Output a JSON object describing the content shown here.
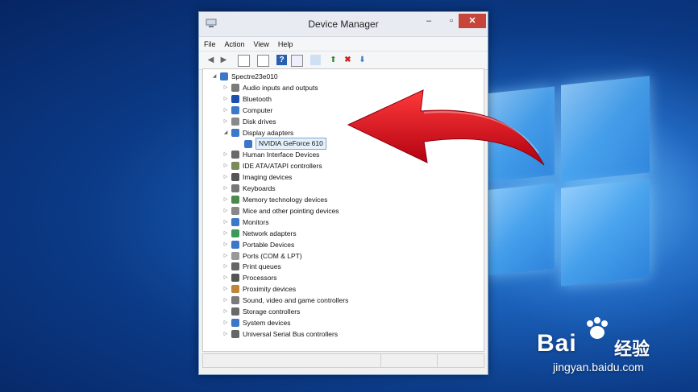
{
  "window": {
    "title": "Device Manager",
    "minimize": "–",
    "maximize": "▫",
    "close": "✕"
  },
  "menu": [
    "File",
    "Action",
    "View",
    "Help"
  ],
  "tree": {
    "root": "Spectre23e010",
    "items": [
      {
        "label": "Audio inputs and outputs",
        "expander": "▷",
        "icon_color": "#7a7a7a"
      },
      {
        "label": "Bluetooth",
        "expander": "▷",
        "icon_color": "#1a4fb0"
      },
      {
        "label": "Computer",
        "expander": "▷",
        "icon_color": "#3b78c8"
      },
      {
        "label": "Disk drives",
        "expander": "▷",
        "icon_color": "#8a8a8a"
      },
      {
        "label": "Display adapters",
        "expander": "◢",
        "icon_color": "#3b78c8"
      },
      {
        "label": "NVIDIA GeForce 610",
        "expander": "",
        "icon_color": "#3b78c8",
        "child": true,
        "selected": true
      },
      {
        "label": "Human Interface Devices",
        "expander": "▷",
        "icon_color": "#6a6a6a"
      },
      {
        "label": "IDE ATA/ATAPI controllers",
        "expander": "▷",
        "icon_color": "#7b8c5a"
      },
      {
        "label": "Imaging devices",
        "expander": "▷",
        "icon_color": "#555"
      },
      {
        "label": "Keyboards",
        "expander": "▷",
        "icon_color": "#777"
      },
      {
        "label": "Memory technology devices",
        "expander": "▷",
        "icon_color": "#4a8a4a"
      },
      {
        "label": "Mice and other pointing devices",
        "expander": "▷",
        "icon_color": "#888"
      },
      {
        "label": "Monitors",
        "expander": "▷",
        "icon_color": "#3b78c8"
      },
      {
        "label": "Network adapters",
        "expander": "▷",
        "icon_color": "#3b9a5a"
      },
      {
        "label": "Portable Devices",
        "expander": "▷",
        "icon_color": "#3b78c8"
      },
      {
        "label": "Ports (COM & LPT)",
        "expander": "▷",
        "icon_color": "#999"
      },
      {
        "label": "Print queues",
        "expander": "▷",
        "icon_color": "#666"
      },
      {
        "label": "Processors",
        "expander": "▷",
        "icon_color": "#555"
      },
      {
        "label": "Proximity devices",
        "expander": "▷",
        "icon_color": "#c0843a"
      },
      {
        "label": "Sound, video and game controllers",
        "expander": "▷",
        "icon_color": "#7a7a7a"
      },
      {
        "label": "Storage controllers",
        "expander": "▷",
        "icon_color": "#6a6a6a"
      },
      {
        "label": "System devices",
        "expander": "▷",
        "icon_color": "#3b78c8"
      },
      {
        "label": "Universal Serial Bus controllers",
        "expander": "▷",
        "icon_color": "#666"
      }
    ]
  },
  "watermark": {
    "brand_latin": "Bai",
    "brand_cn": "经验",
    "url": "jingyan.baidu.com"
  },
  "colors": {
    "arrow": "#e0141e",
    "close_btn": "#c7443a",
    "selection": "#7aa7d6"
  }
}
